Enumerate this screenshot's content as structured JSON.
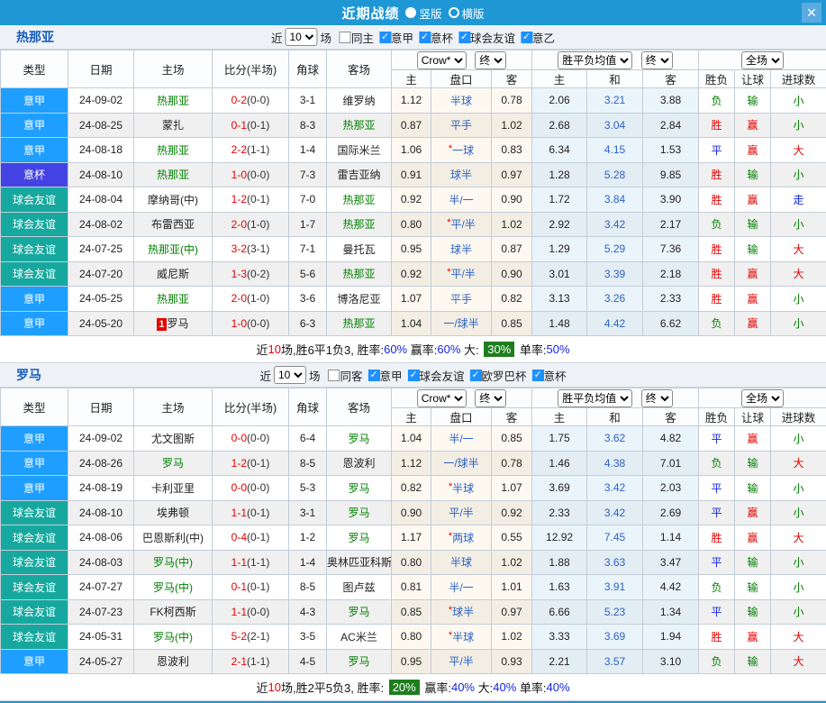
{
  "titlebar": {
    "title": "近期战绩",
    "radio_vertical": "竖版",
    "radio_horizontal": "横版",
    "close": "✕"
  },
  "colors": {
    "titlebar": "#1f97d4",
    "league": {
      "seriea": "#1e9fff",
      "coppa": "#4343e3",
      "friendly": "#16a89e"
    },
    "focus_team_green": "#008000",
    "score_red": "#e60000",
    "blue_text": "#1526e0",
    "summary_badge_green": "#1e7e1e",
    "checkbox_blue": "#1e90ff"
  },
  "header": {
    "type": "类型",
    "date": "日期",
    "home": "主场",
    "score": "比分(半场)",
    "corner": "角球",
    "away": "客场",
    "company": "Crow*",
    "final": "终",
    "avg": "胜平负均值",
    "scope": "全场",
    "h": "主",
    "pankou": "盘口",
    "a": "客",
    "draw": "和",
    "result": "胜负",
    "let": "让球",
    "goals": "进球数"
  },
  "sections": [
    {
      "team": "热那亚",
      "filter": {
        "near_label": "近",
        "count": "10",
        "games_label": "场",
        "same_label": "同主",
        "leagues": [
          "意甲",
          "意杯",
          "球会友谊",
          "意乙"
        ]
      },
      "rows": [
        {
          "league": "意甲",
          "league_color": "seriea",
          "date": "24-09-02",
          "home": "热那亚",
          "home_focus": true,
          "home_badge": "",
          "score_ft": "0-2",
          "score_ht": "(0-0)",
          "corner": "3-1",
          "away": "维罗纳",
          "away_focus": false,
          "odds_home": "1.12",
          "handicap": "半球",
          "handicap_star": false,
          "odds_away": "0.78",
          "avg_home": "2.06",
          "avg_draw": "3.21",
          "avg_away": "3.88",
          "result": {
            "t": "负",
            "c": "g"
          },
          "let_ball": {
            "t": "输",
            "c": "g"
          },
          "goal": {
            "t": "小",
            "c": "g"
          }
        },
        {
          "league": "意甲",
          "league_color": "seriea",
          "date": "24-08-25",
          "home": "蒙扎",
          "home_focus": false,
          "home_badge": "",
          "score_ft": "0-1",
          "score_ht": "(0-1)",
          "corner": "8-3",
          "away": "热那亚",
          "away_focus": true,
          "odds_home": "0.87",
          "handicap": "平手",
          "handicap_star": false,
          "odds_away": "1.02",
          "avg_home": "2.68",
          "avg_draw": "3.04",
          "avg_away": "2.84",
          "result": {
            "t": "胜",
            "c": "r"
          },
          "let_ball": {
            "t": "赢",
            "c": "r"
          },
          "goal": {
            "t": "小",
            "c": "g"
          }
        },
        {
          "league": "意甲",
          "league_color": "seriea",
          "date": "24-08-18",
          "home": "热那亚",
          "home_focus": true,
          "home_badge": "",
          "score_ft": "2-2",
          "score_ht": "(1-1)",
          "corner": "1-4",
          "away": "国际米兰",
          "away_focus": false,
          "odds_home": "1.06",
          "handicap": "一球",
          "handicap_star": true,
          "odds_away": "0.83",
          "avg_home": "6.34",
          "avg_draw": "4.15",
          "avg_away": "1.53",
          "result": {
            "t": "平",
            "c": "b"
          },
          "let_ball": {
            "t": "赢",
            "c": "r"
          },
          "goal": {
            "t": "大",
            "c": "r"
          }
        },
        {
          "league": "意杯",
          "league_color": "coppa",
          "date": "24-08-10",
          "home": "热那亚",
          "home_focus": true,
          "home_badge": "",
          "score_ft": "1-0",
          "score_ht": "(0-0)",
          "corner": "7-3",
          "away": "雷吉亚纳",
          "away_focus": false,
          "odds_home": "0.91",
          "handicap": "球半",
          "handicap_star": false,
          "odds_away": "0.97",
          "avg_home": "1.28",
          "avg_draw": "5.28",
          "avg_away": "9.85",
          "result": {
            "t": "胜",
            "c": "r"
          },
          "let_ball": {
            "t": "输",
            "c": "g"
          },
          "goal": {
            "t": "小",
            "c": "g"
          }
        },
        {
          "league": "球会友谊",
          "league_color": "friendly",
          "date": "24-08-04",
          "home": "摩纳哥(中)",
          "home_focus": false,
          "home_badge": "",
          "score_ft": "1-2",
          "score_ht": "(0-1)",
          "corner": "7-0",
          "away": "热那亚",
          "away_focus": true,
          "odds_home": "0.92",
          "handicap": "半/一",
          "handicap_star": false,
          "odds_away": "0.90",
          "avg_home": "1.72",
          "avg_draw": "3.84",
          "avg_away": "3.90",
          "result": {
            "t": "胜",
            "c": "r"
          },
          "let_ball": {
            "t": "赢",
            "c": "r"
          },
          "goal": {
            "t": "走",
            "c": "b"
          }
        },
        {
          "league": "球会友谊",
          "league_color": "friendly",
          "date": "24-08-02",
          "home": "布雷西亚",
          "home_focus": false,
          "home_badge": "",
          "score_ft": "2-0",
          "score_ht": "(1-0)",
          "corner": "1-7",
          "away": "热那亚",
          "away_focus": true,
          "odds_home": "0.80",
          "handicap": "平/半",
          "handicap_star": true,
          "odds_away": "1.02",
          "avg_home": "2.92",
          "avg_draw": "3.42",
          "avg_away": "2.17",
          "result": {
            "t": "负",
            "c": "g"
          },
          "let_ball": {
            "t": "输",
            "c": "g"
          },
          "goal": {
            "t": "小",
            "c": "g"
          }
        },
        {
          "league": "球会友谊",
          "league_color": "friendly",
          "date": "24-07-25",
          "home": "热那亚(中)",
          "home_focus": true,
          "home_badge": "",
          "score_ft": "3-2",
          "score_ht": "(3-1)",
          "corner": "7-1",
          "away": "曼托瓦",
          "away_focus": false,
          "odds_home": "0.95",
          "handicap": "球半",
          "handicap_star": false,
          "odds_away": "0.87",
          "avg_home": "1.29",
          "avg_draw": "5.29",
          "avg_away": "7.36",
          "result": {
            "t": "胜",
            "c": "r"
          },
          "let_ball": {
            "t": "输",
            "c": "g"
          },
          "goal": {
            "t": "大",
            "c": "r"
          }
        },
        {
          "league": "球会友谊",
          "league_color": "friendly",
          "date": "24-07-20",
          "home": "威尼斯",
          "home_focus": false,
          "home_badge": "",
          "score_ft": "1-3",
          "score_ht": "(0-2)",
          "corner": "5-6",
          "away": "热那亚",
          "away_focus": true,
          "odds_home": "0.92",
          "handicap": "平/半",
          "handicap_star": true,
          "odds_away": "0.90",
          "avg_home": "3.01",
          "avg_draw": "3.39",
          "avg_away": "2.18",
          "result": {
            "t": "胜",
            "c": "r"
          },
          "let_ball": {
            "t": "赢",
            "c": "r"
          },
          "goal": {
            "t": "大",
            "c": "r"
          }
        },
        {
          "league": "意甲",
          "league_color": "seriea",
          "date": "24-05-25",
          "home": "热那亚",
          "home_focus": true,
          "home_badge": "",
          "score_ft": "2-0",
          "score_ht": "(1-0)",
          "corner": "3-6",
          "away": "博洛尼亚",
          "away_focus": false,
          "odds_home": "1.07",
          "handicap": "平手",
          "handicap_star": false,
          "odds_away": "0.82",
          "avg_home": "3.13",
          "avg_draw": "3.26",
          "avg_away": "2.33",
          "result": {
            "t": "胜",
            "c": "r"
          },
          "let_ball": {
            "t": "赢",
            "c": "r"
          },
          "goal": {
            "t": "小",
            "c": "g"
          }
        },
        {
          "league": "意甲",
          "league_color": "seriea",
          "date": "24-05-20",
          "home": "罗马",
          "home_focus": false,
          "home_badge": "1",
          "score_ft": "1-0",
          "score_ht": "(0-0)",
          "corner": "6-3",
          "away": "热那亚",
          "away_focus": true,
          "odds_home": "1.04",
          "handicap": "一/球半",
          "handicap_star": false,
          "odds_away": "0.85",
          "avg_home": "1.48",
          "avg_draw": "4.42",
          "avg_away": "6.62",
          "result": {
            "t": "负",
            "c": "g"
          },
          "let_ball": {
            "t": "赢",
            "c": "r"
          },
          "goal": {
            "t": "小",
            "c": "g"
          }
        }
      ],
      "summary": [
        {
          "t": "近",
          "c": "k"
        },
        {
          "t": "10",
          "c": "r"
        },
        {
          "t": "场,胜6平1负3, 胜率:",
          "c": "k"
        },
        {
          "t": "60%",
          "c": "b"
        },
        {
          "t": " 赢率:",
          "c": "k"
        },
        {
          "t": "60%",
          "c": "b"
        },
        {
          "t": " 大: ",
          "c": "k"
        },
        {
          "t": "30%",
          "c": "badge"
        },
        {
          "t": " 单率:",
          "c": "k"
        },
        {
          "t": "50%",
          "c": "b"
        }
      ]
    },
    {
      "team": "罗马",
      "filter": {
        "near_label": "近",
        "count": "10",
        "games_label": "场",
        "same_label": "同客",
        "leagues": [
          "意甲",
          "球会友谊",
          "欧罗巴杯",
          "意杯"
        ]
      },
      "rows": [
        {
          "league": "意甲",
          "league_color": "seriea",
          "date": "24-09-02",
          "home": "尤文图斯",
          "home_focus": false,
          "home_badge": "",
          "score_ft": "0-0",
          "score_ht": "(0-0)",
          "corner": "6-4",
          "away": "罗马",
          "away_focus": true,
          "odds_home": "1.04",
          "handicap": "半/一",
          "handicap_star": false,
          "odds_away": "0.85",
          "avg_home": "1.75",
          "avg_draw": "3.62",
          "avg_away": "4.82",
          "result": {
            "t": "平",
            "c": "b"
          },
          "let_ball": {
            "t": "赢",
            "c": "r"
          },
          "goal": {
            "t": "小",
            "c": "g"
          }
        },
        {
          "league": "意甲",
          "league_color": "seriea",
          "date": "24-08-26",
          "home": "罗马",
          "home_focus": true,
          "home_badge": "",
          "score_ft": "1-2",
          "score_ht": "(0-1)",
          "corner": "8-5",
          "away": "恩波利",
          "away_focus": false,
          "odds_home": "1.12",
          "handicap": "一/球半",
          "handicap_star": false,
          "odds_away": "0.78",
          "avg_home": "1.46",
          "avg_draw": "4.38",
          "avg_away": "7.01",
          "result": {
            "t": "负",
            "c": "g"
          },
          "let_ball": {
            "t": "输",
            "c": "g"
          },
          "goal": {
            "t": "大",
            "c": "r"
          }
        },
        {
          "league": "意甲",
          "league_color": "seriea",
          "date": "24-08-19",
          "home": "卡利亚里",
          "home_focus": false,
          "home_badge": "",
          "score_ft": "0-0",
          "score_ht": "(0-0)",
          "corner": "5-3",
          "away": "罗马",
          "away_focus": true,
          "odds_home": "0.82",
          "handicap": "半球",
          "handicap_star": true,
          "odds_away": "1.07",
          "avg_home": "3.69",
          "avg_draw": "3.42",
          "avg_away": "2.03",
          "result": {
            "t": "平",
            "c": "b"
          },
          "let_ball": {
            "t": "输",
            "c": "g"
          },
          "goal": {
            "t": "小",
            "c": "g"
          }
        },
        {
          "league": "球会友谊",
          "league_color": "friendly",
          "date": "24-08-10",
          "home": "埃弗顿",
          "home_focus": false,
          "home_badge": "",
          "score_ft": "1-1",
          "score_ht": "(0-1)",
          "corner": "3-1",
          "away": "罗马",
          "away_focus": true,
          "odds_home": "0.90",
          "handicap": "平/半",
          "handicap_star": false,
          "odds_away": "0.92",
          "avg_home": "2.33",
          "avg_draw": "3.42",
          "avg_away": "2.69",
          "result": {
            "t": "平",
            "c": "b"
          },
          "let_ball": {
            "t": "赢",
            "c": "r"
          },
          "goal": {
            "t": "小",
            "c": "g"
          }
        },
        {
          "league": "球会友谊",
          "league_color": "friendly",
          "date": "24-08-06",
          "home": "巴恩斯利(中)",
          "home_focus": false,
          "home_badge": "",
          "score_ft": "0-4",
          "score_ht": "(0-1)",
          "corner": "1-2",
          "away": "罗马",
          "away_focus": true,
          "odds_home": "1.17",
          "handicap": "两球",
          "handicap_star": true,
          "odds_away": "0.55",
          "avg_home": "12.92",
          "avg_draw": "7.45",
          "avg_away": "1.14",
          "result": {
            "t": "胜",
            "c": "r"
          },
          "let_ball": {
            "t": "赢",
            "c": "r"
          },
          "goal": {
            "t": "大",
            "c": "r"
          }
        },
        {
          "league": "球会友谊",
          "league_color": "friendly",
          "date": "24-08-03",
          "home": "罗马(中)",
          "home_focus": true,
          "home_badge": "",
          "score_ft": "1-1",
          "score_ht": "(1-1)",
          "corner": "1-4",
          "away": "奥林匹亚科斯",
          "away_focus": false,
          "odds_home": "0.80",
          "handicap": "半球",
          "handicap_star": false,
          "odds_away": "1.02",
          "avg_home": "1.88",
          "avg_draw": "3.63",
          "avg_away": "3.47",
          "result": {
            "t": "平",
            "c": "b"
          },
          "let_ball": {
            "t": "输",
            "c": "g"
          },
          "goal": {
            "t": "小",
            "c": "g"
          }
        },
        {
          "league": "球会友谊",
          "league_color": "friendly",
          "date": "24-07-27",
          "home": "罗马(中)",
          "home_focus": true,
          "home_badge": "",
          "score_ft": "0-1",
          "score_ht": "(0-1)",
          "corner": "8-5",
          "away": "图卢兹",
          "away_focus": false,
          "odds_home": "0.81",
          "handicap": "半/一",
          "handicap_star": false,
          "odds_away": "1.01",
          "avg_home": "1.63",
          "avg_draw": "3.91",
          "avg_away": "4.42",
          "result": {
            "t": "负",
            "c": "g"
          },
          "let_ball": {
            "t": "输",
            "c": "g"
          },
          "goal": {
            "t": "小",
            "c": "g"
          }
        },
        {
          "league": "球会友谊",
          "league_color": "friendly",
          "date": "24-07-23",
          "home": "FK柯西斯",
          "home_focus": false,
          "home_badge": "",
          "score_ft": "1-1",
          "score_ht": "(0-0)",
          "corner": "4-3",
          "away": "罗马",
          "away_focus": true,
          "odds_home": "0.85",
          "handicap": "球半",
          "handicap_star": true,
          "odds_away": "0.97",
          "avg_home": "6.66",
          "avg_draw": "5.23",
          "avg_away": "1.34",
          "result": {
            "t": "平",
            "c": "b"
          },
          "let_ball": {
            "t": "输",
            "c": "g"
          },
          "goal": {
            "t": "小",
            "c": "g"
          }
        },
        {
          "league": "球会友谊",
          "league_color": "friendly",
          "date": "24-05-31",
          "home": "罗马(中)",
          "home_focus": true,
          "home_badge": "",
          "score_ft": "5-2",
          "score_ht": "(2-1)",
          "corner": "3-5",
          "away": "AC米兰",
          "away_focus": false,
          "odds_home": "0.80",
          "handicap": "半球",
          "handicap_star": true,
          "odds_away": "1.02",
          "avg_home": "3.33",
          "avg_draw": "3.69",
          "avg_away": "1.94",
          "result": {
            "t": "胜",
            "c": "r"
          },
          "let_ball": {
            "t": "赢",
            "c": "r"
          },
          "goal": {
            "t": "大",
            "c": "r"
          }
        },
        {
          "league": "意甲",
          "league_color": "seriea",
          "date": "24-05-27",
          "home": "恩波利",
          "home_focus": false,
          "home_badge": "",
          "score_ft": "2-1",
          "score_ht": "(1-1)",
          "corner": "4-5",
          "away": "罗马",
          "away_focus": true,
          "odds_home": "0.95",
          "handicap": "平/半",
          "handicap_star": false,
          "odds_away": "0.93",
          "avg_home": "2.21",
          "avg_draw": "3.57",
          "avg_away": "3.10",
          "result": {
            "t": "负",
            "c": "g"
          },
          "let_ball": {
            "t": "输",
            "c": "g"
          },
          "goal": {
            "t": "大",
            "c": "r"
          }
        }
      ],
      "summary": [
        {
          "t": "近",
          "c": "k"
        },
        {
          "t": "10",
          "c": "r"
        },
        {
          "t": "场,胜2平5负3, 胜率: ",
          "c": "k"
        },
        {
          "t": "20%",
          "c": "badge"
        },
        {
          "t": " 赢率:",
          "c": "k"
        },
        {
          "t": "40%",
          "c": "b"
        },
        {
          "t": " 大:",
          "c": "k"
        },
        {
          "t": "40%",
          "c": "b"
        },
        {
          "t": " 单率:",
          "c": "k"
        },
        {
          "t": "40%",
          "c": "b"
        }
      ]
    }
  ]
}
